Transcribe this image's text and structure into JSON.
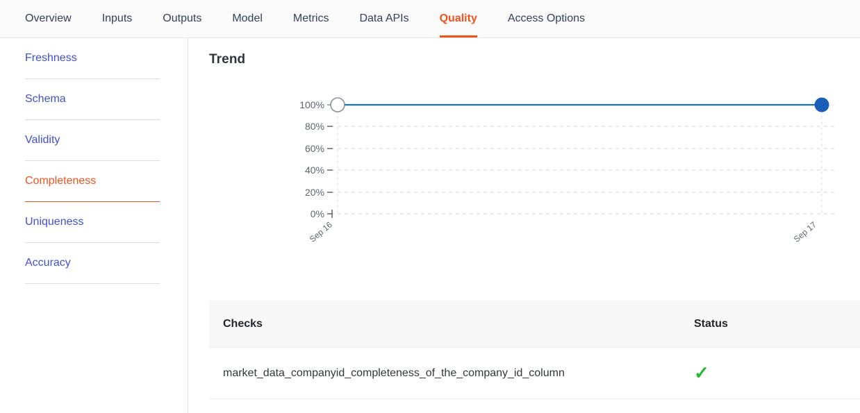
{
  "header": {
    "tabs": [
      {
        "label": "Overview",
        "active": false
      },
      {
        "label": "Inputs",
        "active": false
      },
      {
        "label": "Outputs",
        "active": false
      },
      {
        "label": "Model",
        "active": false
      },
      {
        "label": "Metrics",
        "active": false
      },
      {
        "label": "Data APIs",
        "active": false
      },
      {
        "label": "Quality",
        "active": true
      },
      {
        "label": "Access Options",
        "active": false
      }
    ],
    "active_tab": "Quality",
    "active_color": "#f4511e"
  },
  "sidebar": {
    "items": [
      {
        "label": "Freshness",
        "active": false
      },
      {
        "label": "Schema",
        "active": false
      },
      {
        "label": "Validity",
        "active": false
      },
      {
        "label": "Completeness",
        "active": true
      },
      {
        "label": "Uniqueness",
        "active": false
      },
      {
        "label": "Accuracy",
        "active": false
      }
    ],
    "active_item": "Completeness",
    "link_color": "#3f51d4",
    "active_color": "#f4511e"
  },
  "main": {
    "trend_title": "Trend"
  },
  "chart_data": {
    "type": "line",
    "title": "Trend",
    "xlabel": "",
    "ylabel": "",
    "x": [
      "Sep 16",
      "Sep 17"
    ],
    "categories": [
      "Sep 16",
      "Sep 17"
    ],
    "values": [
      100,
      100
    ],
    "series": [
      {
        "name": "Completeness",
        "values": [
          100,
          100
        ]
      }
    ],
    "ylim": [
      0,
      100
    ],
    "ytick_labels": [
      "100%",
      "80%",
      "60%",
      "40%",
      "20%",
      "0%"
    ],
    "ytick_values": [
      100,
      80,
      60,
      40,
      20,
      0
    ],
    "xtick_labels": [
      "Sep 16",
      "Sep 17"
    ],
    "xtick_rotation": -45,
    "grid": true,
    "grid_style": "dashed",
    "grid_color": "#d8d8d8",
    "line_color": "#1a73a8",
    "marker_colors": [
      "#ffffff",
      "#1a5eb8"
    ],
    "marker_styles": [
      "open-circle",
      "filled-circle"
    ],
    "legend": "none"
  },
  "checks_table": {
    "columns": [
      "Checks",
      "Status"
    ],
    "rows": [
      {
        "check": "market_data_companyid_completeness_of_the_company_id_column",
        "status_icon": "check-mark",
        "status_color": "#23b930"
      }
    ]
  }
}
